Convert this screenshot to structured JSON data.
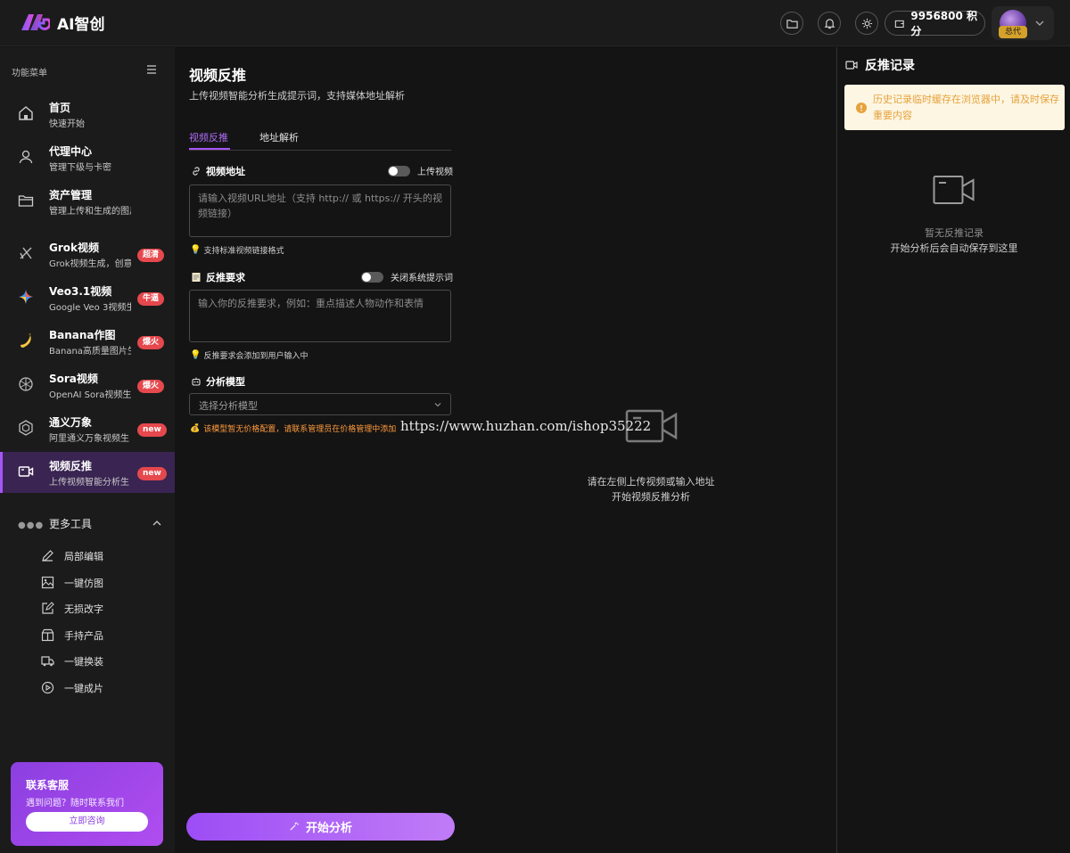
{
  "app": {
    "name": "AI智创"
  },
  "header": {
    "points": "9956800 积分",
    "avatar_badge": "总代"
  },
  "sidebar": {
    "menu_title": "功能菜单",
    "items": [
      {
        "title": "首页",
        "sub": "快速开始",
        "badge": ""
      },
      {
        "title": "代理中心",
        "sub": "管理下级与卡密",
        "badge": ""
      },
      {
        "title": "资产管理",
        "sub": "管理上传和生成的图片",
        "badge": ""
      },
      {
        "title": "Grok视频",
        "sub": "Grok视频生成，创意",
        "badge": "超清"
      },
      {
        "title": "Veo3.1视频",
        "sub": "Google Veo 3视频生",
        "badge": "牛逼"
      },
      {
        "title": "Banana作图",
        "sub": "Banana高质量图片生",
        "badge": "爆火"
      },
      {
        "title": "Sora视频",
        "sub": "OpenAI Sora视频生成",
        "badge": "爆火"
      },
      {
        "title": "通义万象",
        "sub": "阿里通义万象视频生",
        "badge": "new"
      },
      {
        "title": "视频反推",
        "sub": "上传视频智能分析生",
        "badge": "new"
      }
    ],
    "more_title": "更多工具",
    "tools": [
      {
        "label": "局部编辑"
      },
      {
        "label": "一键仿图"
      },
      {
        "label": "无损改字"
      },
      {
        "label": "手持产品"
      },
      {
        "label": "一键换装"
      },
      {
        "label": "一键成片"
      }
    ],
    "support": {
      "title": "联系客服",
      "sub": "遇到问题？随时联系我们",
      "button": "立即咨询"
    }
  },
  "main": {
    "title": "视频反推",
    "subtitle": "上传视频智能分析生成提示词，支持媒体地址解析",
    "tabs": [
      {
        "label": "视频反推"
      },
      {
        "label": "地址解析"
      }
    ],
    "video_url": {
      "label": "视频地址",
      "toggle_label": "上传视频",
      "placeholder": "请输入视频URL地址（支持 http:// 或 https:// 开头的视频链接）",
      "hint": "支持标准视频链接格式"
    },
    "requirement": {
      "label": "反推要求",
      "toggle_label": "关闭系统提示词",
      "placeholder": "输入你的反推要求，例如：重点描述人物动作和表情",
      "hint": "反推要求会添加到用户输入中"
    },
    "model": {
      "label": "分析模型",
      "placeholder": "选择分析模型",
      "warning": "该模型暂无价格配置，请联系管理员在价格管理中添加"
    },
    "start_button": "开始分析"
  },
  "center": {
    "watermark": "https://www.huzhan.com/ishop35222",
    "line1": "请在左侧上传视频或输入地址",
    "line2": "开始视频反推分析"
  },
  "right_panel": {
    "title": "反推记录",
    "alert": "历史记录临时缓存在浏览器中，请及时保存重要内容",
    "empty_title": "暂无反推记录",
    "empty_sub": "开始分析后会自动保存到这里"
  },
  "colors": {
    "accent": "#a855f7",
    "badge": "#e5484d",
    "warning": "#ff9a3c",
    "alert_bg": "#fdf6e3",
    "alert_text": "#e6a23c"
  }
}
